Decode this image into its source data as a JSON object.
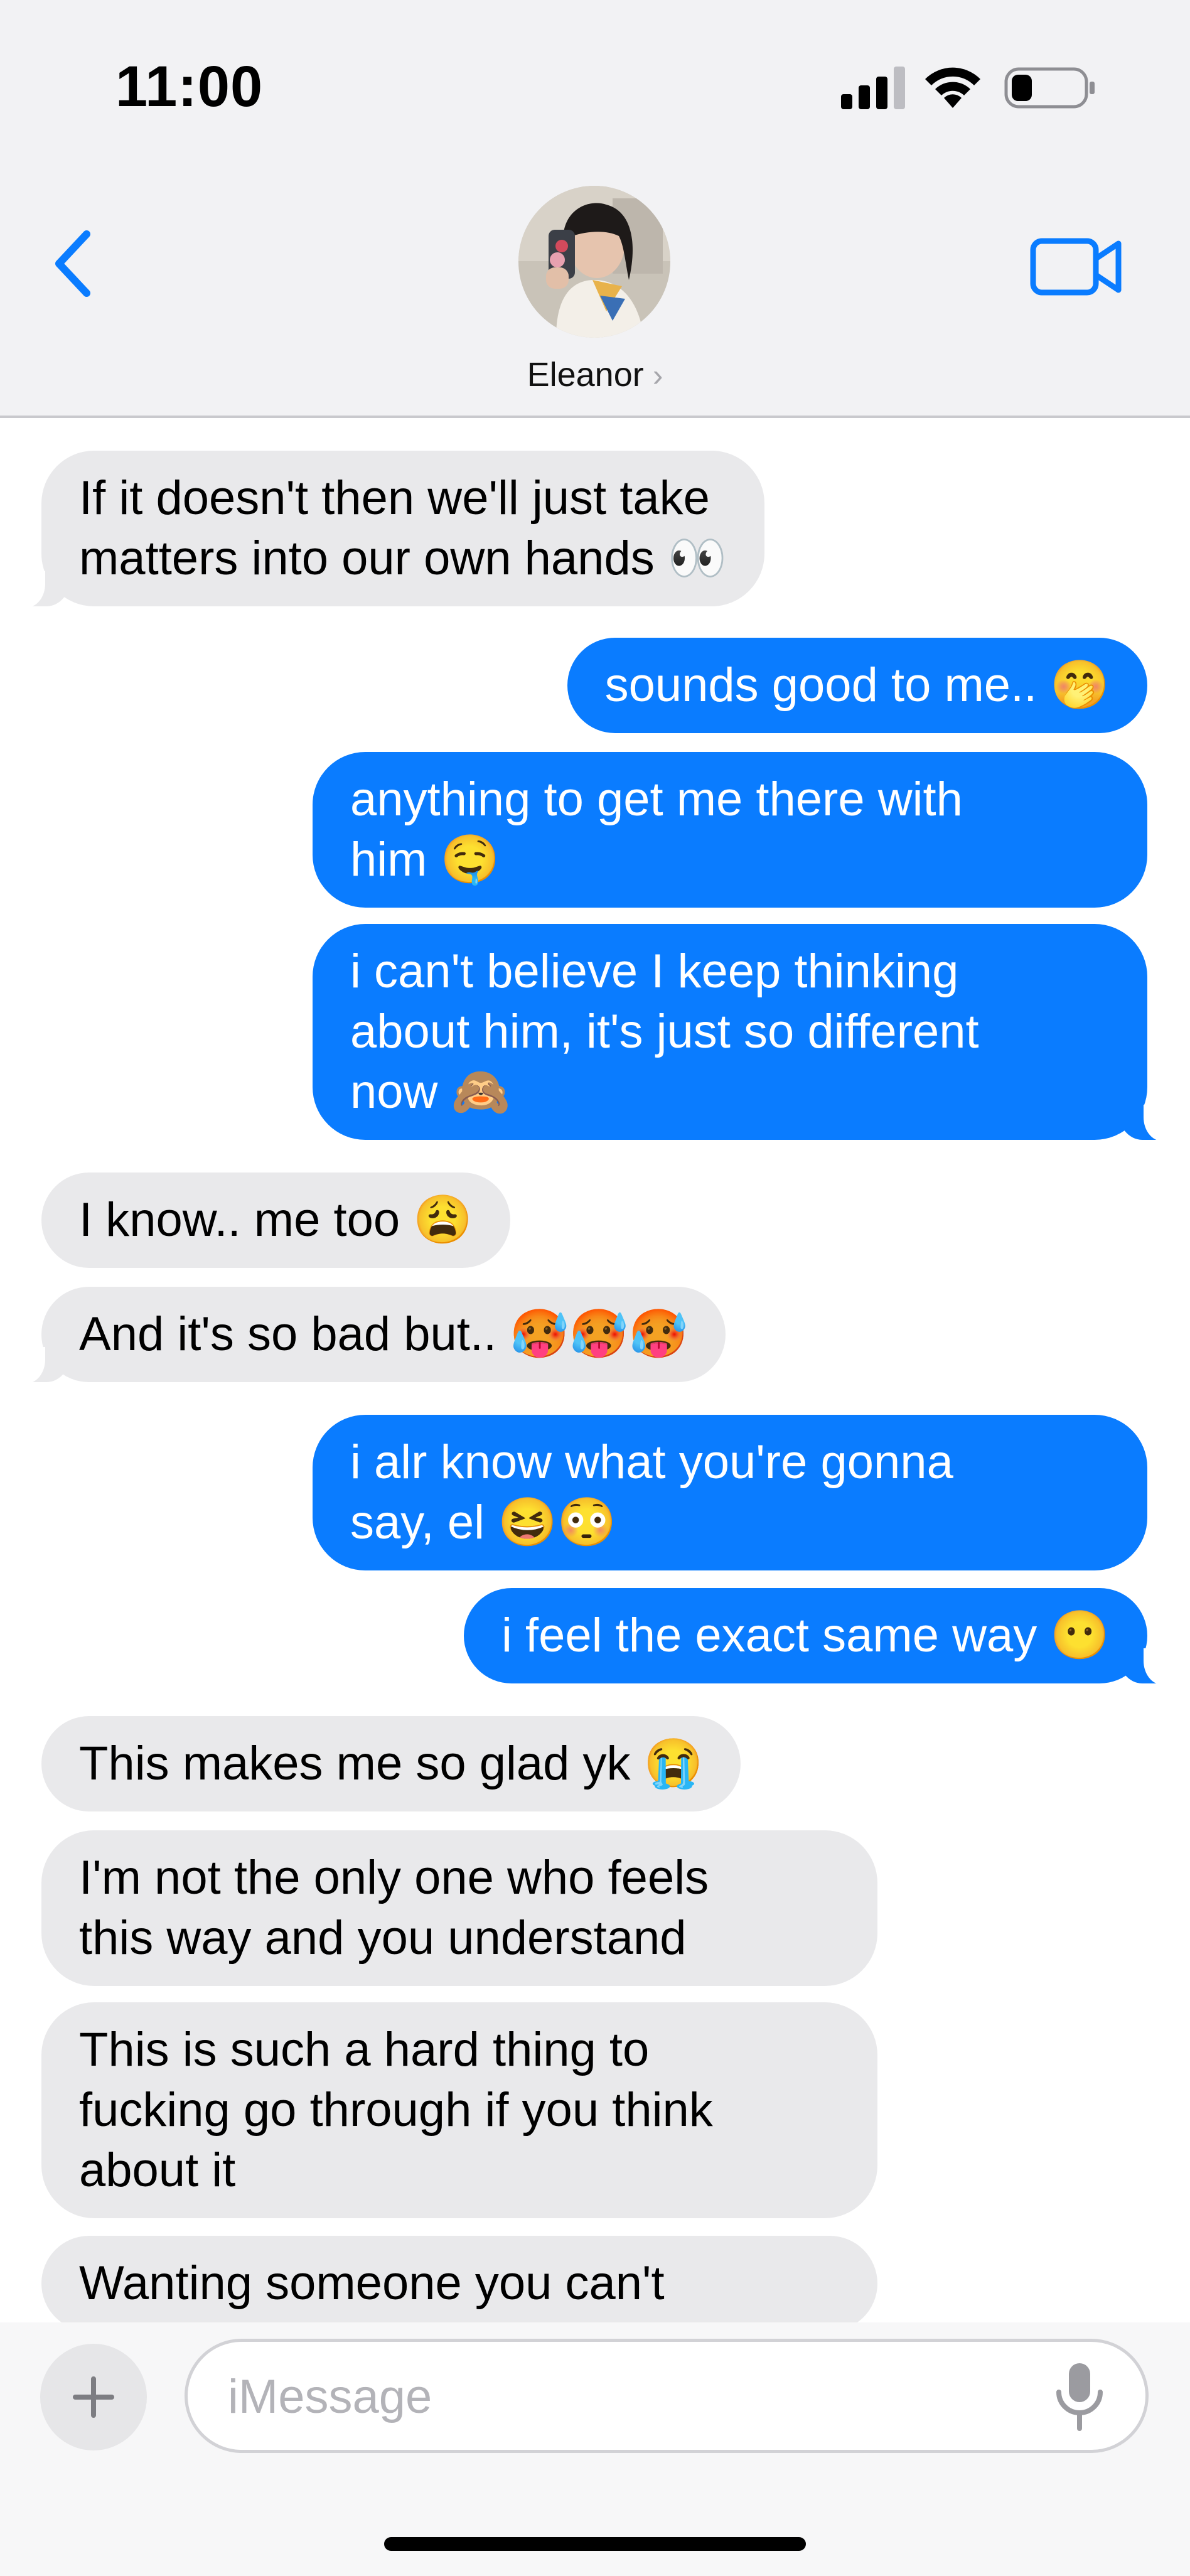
{
  "status_bar": {
    "time": "11:00"
  },
  "header": {
    "contact_name": "Eleanor",
    "chevron": "›",
    "icons": {
      "back": "chevron-left-icon",
      "video": "video-camera-icon"
    },
    "accent_color": "#0a7cff"
  },
  "messages": [
    {
      "direction": "incoming",
      "text": "If it doesn't then we'll just take\nmatters into our own hands 👀"
    },
    {
      "direction": "outgoing",
      "text": "sounds good to me.. 🤭"
    },
    {
      "direction": "outgoing",
      "text": "anything to get me there with\nhim 🤤"
    },
    {
      "direction": "outgoing",
      "text": "i can't believe I keep thinking\nabout him, it's just so different\nnow 🙈"
    },
    {
      "direction": "incoming",
      "text": "I know.. me too 😩"
    },
    {
      "direction": "incoming",
      "text": "And it's so bad but.. 🥵🥵🥵"
    },
    {
      "direction": "outgoing",
      "text": "i alr know what you're gonna\nsay, el 😆😳"
    },
    {
      "direction": "outgoing",
      "text": "i feel the exact same way 😶"
    },
    {
      "direction": "incoming",
      "text": "This makes me so glad yk 😭"
    },
    {
      "direction": "incoming",
      "text": "I'm not the only one who feels\nthis way and you understand"
    },
    {
      "direction": "incoming",
      "text": "This is such a hard thing to\nfucking go through if you think\nabout it"
    },
    {
      "direction": "incoming",
      "text": "Wanting someone you can't"
    }
  ],
  "composer": {
    "placeholder": "iMessage",
    "value": "",
    "plus_label": "+",
    "icons": {
      "plus": "plus-icon",
      "mic": "microphone-icon"
    }
  },
  "colors": {
    "incoming_bubble": "#e9e9eb",
    "outgoing_bubble": "#0a7cff",
    "header_bg": "#f2f2f4"
  }
}
